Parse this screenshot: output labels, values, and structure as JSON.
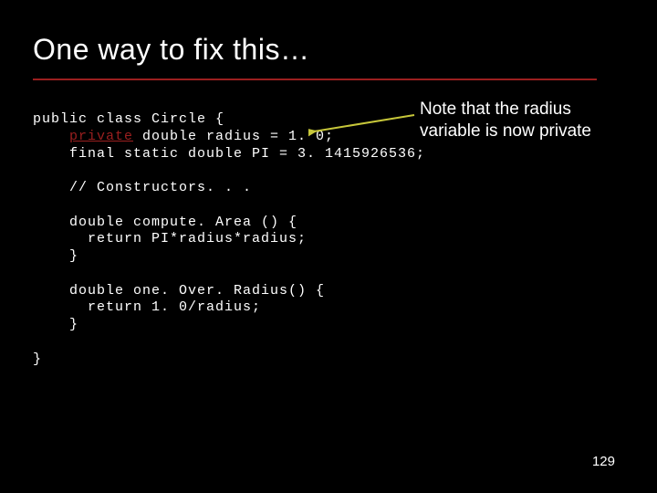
{
  "title": "One way to fix this…",
  "note": "Note that the radius variable is now private",
  "page_number": "129",
  "code": {
    "l1": "public class Circle {",
    "kw": "private",
    "l2b": " double radius = 1. 0;",
    "l3": "    final static double PI = 3. 1415926536;",
    "l4": "",
    "l5": "    // Constructors. . .",
    "l6": "",
    "l7": "    double compute. Area () {",
    "l8": "      return PI*radius*radius;",
    "l9": "    }",
    "l10": "",
    "l11": "    double one. Over. Radius() {",
    "l12": "      return 1. 0/radius;",
    "l13": "    }",
    "l14": "",
    "l15": "}"
  }
}
